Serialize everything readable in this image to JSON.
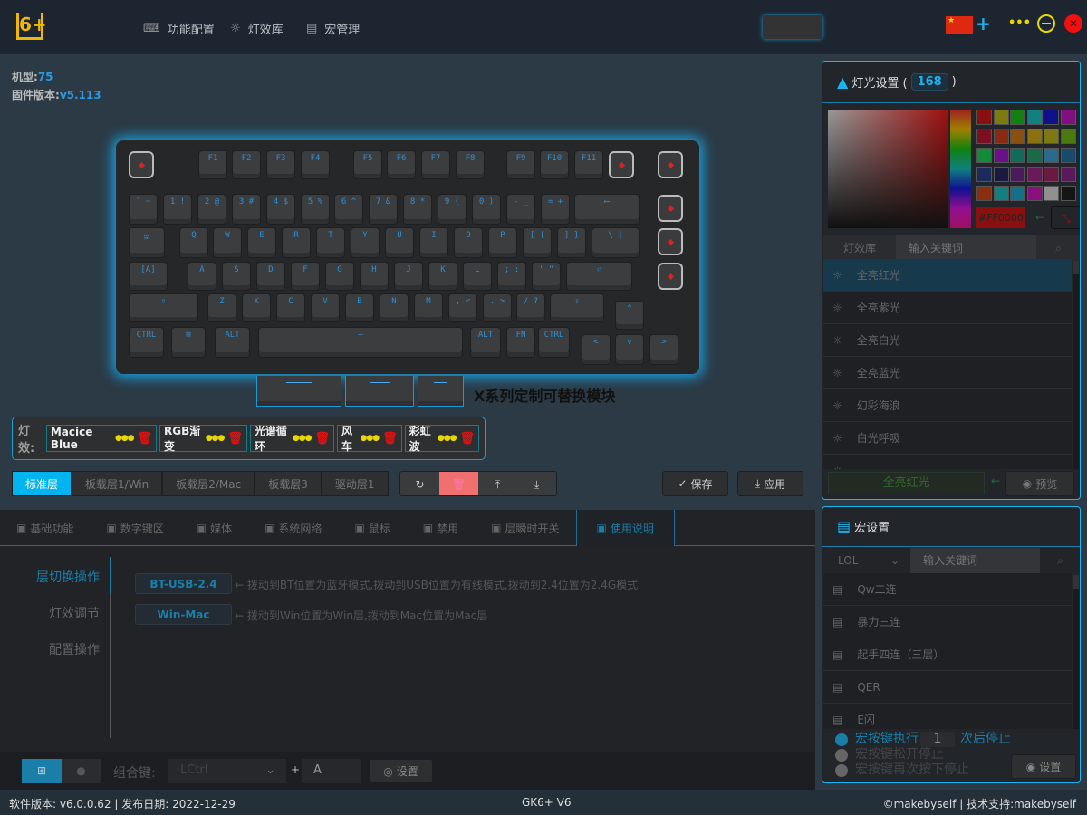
{
  "header": {
    "logo": "6+",
    "nav": [
      {
        "icon": "keyboard-icon",
        "label": "功能配置"
      },
      {
        "icon": "bulb-icon",
        "label": "灯效库"
      },
      {
        "icon": "document-icon",
        "label": "宏管理"
      }
    ],
    "add": "+",
    "more": "•••"
  },
  "device": {
    "model_label": "机型:",
    "model": "75",
    "fw_label": "固件版本:",
    "fw": "v5.113"
  },
  "keyboard": {
    "rows": [
      [
        "F1",
        "F2",
        "F3",
        "F4",
        "F5",
        "F6",
        "F7",
        "F8",
        "F9",
        "F10",
        "F11"
      ],
      [
        "` ~",
        "1 !",
        "2 @",
        "3 #",
        "4 $",
        "5 %",
        "6 ^",
        "7 &",
        "8 *",
        "9 (",
        "0 )",
        "- _",
        "= +",
        "⟵"
      ],
      [
        "⭾",
        "Q",
        "W",
        "E",
        "R",
        "T",
        "Y",
        "U",
        "I",
        "O",
        "P",
        "[ {",
        "] }",
        "\\ |"
      ],
      [
        "[A]",
        "A",
        "S",
        "D",
        "F",
        "G",
        "H",
        "J",
        "K",
        "L",
        "; :",
        "' \"",
        "⏎"
      ],
      [
        "⇧",
        "Z",
        "X",
        "C",
        "V",
        "B",
        "N",
        "M",
        ", <",
        ". >",
        "/ ?",
        "⇧",
        "^"
      ],
      [
        "CTRL",
        "⊞",
        "ALT",
        "—",
        "ALT",
        "FN",
        "CTRL",
        "<",
        "v",
        ">"
      ]
    ],
    "module_label": "X系列定制可替换模块"
  },
  "effects": {
    "label": "灯效:",
    "items": [
      "Macice Blue",
      "RGB渐变",
      "光谱循环",
      "风车",
      "彩虹波"
    ]
  },
  "layers": {
    "items": [
      "标准层",
      "板载层1/Win",
      "板载层2/Mac",
      "板载层3",
      "驱动层1"
    ],
    "active": 0
  },
  "actions": {
    "save": "保存",
    "apply": "应用"
  },
  "tabs": {
    "items": [
      {
        "icon": "keyboard-icon",
        "label": "基础功能"
      },
      {
        "icon": "calculator-icon",
        "label": "数字键区"
      },
      {
        "icon": "play-icon",
        "label": "媒体"
      },
      {
        "icon": "monitor-icon",
        "label": "系统网络"
      },
      {
        "icon": "mouse-icon",
        "label": "鼠标"
      },
      {
        "icon": "ban-icon",
        "label": "禁用"
      },
      {
        "icon": "copy-icon",
        "label": "层瞬时开关"
      },
      {
        "icon": "list-icon",
        "label": "使用说明"
      }
    ],
    "active": 7
  },
  "guide": {
    "menu": [
      "层切换操作",
      "灯效调节",
      "配置操作"
    ],
    "rows": [
      {
        "key": "BT-USB-2.4",
        "desc": "← 拨动到BT位置为蓝牙模式,拨动到USB位置为有线模式,拨动到2.4位置为2.4G模式"
      },
      {
        "key": "Win-Mac",
        "desc": "← 拨动到Win位置为Win层,拨动到Mac位置为Mac层"
      }
    ]
  },
  "combo": {
    "label": "组合键:",
    "modifier": "LCtrl",
    "plus": "+",
    "key": "A",
    "set": "设置"
  },
  "status": {
    "left": "软件版本: v6.0.0.62 | 发布日期: 2022-12-29",
    "center": "GK6+ V6",
    "right": "©makebyself | 技术支持:makebyself"
  },
  "light": {
    "title": "灯光设置 (",
    "count": "168",
    "close": ")",
    "hex": "#FF0000",
    "lib": "灯效库",
    "placeholder": "输入关键词",
    "items": [
      "全亮红光",
      "全亮紫光",
      "全亮白光",
      "全亮蓝光",
      "幻彩海浪",
      "白光呼吸"
    ],
    "selected": "全亮红光",
    "preview": "预览",
    "swatches": [
      "#8a1010",
      "#7d7a10",
      "#128012",
      "#128080",
      "#10108a",
      "#801080",
      "#7a1020",
      "#8a2a10",
      "#8a5010",
      "#8a7010",
      "#7a7a10",
      "#4a7a10",
      "#128a3a",
      "#6a108a",
      "#126a5a",
      "#1a6a4a",
      "#2a6a8a",
      "#1a4a6a",
      "#1a2a5a",
      "#1a1a40",
      "#4a1a5a",
      "#6a1a5a",
      "#6a1a40",
      "#5a1a5a",
      "#8a3010",
      "#128080",
      "#12708a",
      "#8a1080",
      "#909090",
      "#151515"
    ]
  },
  "macro": {
    "title": "宏设置",
    "game": "LOL",
    "placeholder": "输入关键词",
    "items": [
      "Qw二连",
      "暴力三连",
      "起手四连（三层）",
      "QER",
      "E闪"
    ],
    "opt1a": "宏按键执行",
    "count": "1",
    "opt1b": "次后停止",
    "opt2": "宏按键松开停止",
    "opt3": "宏按键再次按下停止",
    "set": "设置"
  },
  "colors": {
    "accent": "#00b4f0",
    "danger": "#f07070",
    "yellow": "#e8d800"
  }
}
